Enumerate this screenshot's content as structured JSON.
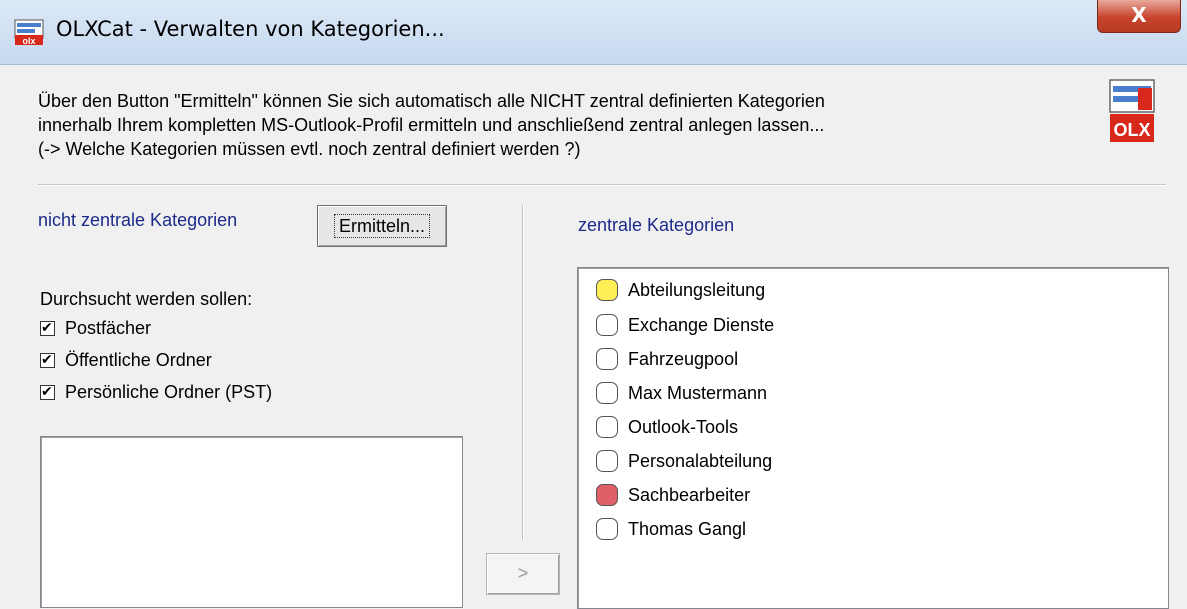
{
  "window": {
    "title": "OLXCat - Verwalten von Kategorien...",
    "close_label": "X"
  },
  "intro": {
    "line1": "Über den Button \"Ermitteln\" können Sie sich automatisch alle NICHT zentral definierten Kategorien",
    "line2": "innerhalb Ihrem kompletten MS-Outlook-Profil ermitteln und anschließend zentral anlegen lassen...",
    "line3": "(-> Welche Kategorien müssen evtl. noch zentral definiert werden ?)"
  },
  "logo_text": "OLX",
  "left": {
    "heading": "nicht zentrale Kategorien",
    "ermitteln_label": "Ermitteln...",
    "search_label": "Durchsucht werden sollen:",
    "checkboxes": [
      {
        "label": "Postfächer",
        "checked": true
      },
      {
        "label": "Öffentliche Ordner",
        "checked": true
      },
      {
        "label": "Persönliche Ordner (PST)",
        "checked": true
      }
    ]
  },
  "transfer_label": ">",
  "right": {
    "heading": "zentrale Kategorien",
    "categories": [
      {
        "name": "Abteilungsleitung",
        "color": "#ffee55"
      },
      {
        "name": "Exchange Dienste",
        "color": "#ffffff"
      },
      {
        "name": "Fahrzeugpool",
        "color": "#ffffff"
      },
      {
        "name": "Max Mustermann",
        "color": "#ffffff"
      },
      {
        "name": "Outlook-Tools",
        "color": "#ffffff"
      },
      {
        "name": "Personalabteilung",
        "color": "#ffffff"
      },
      {
        "name": "Sachbearbeiter",
        "color": "#e0606a"
      },
      {
        "name": "Thomas Gangl",
        "color": "#ffffff"
      }
    ]
  }
}
